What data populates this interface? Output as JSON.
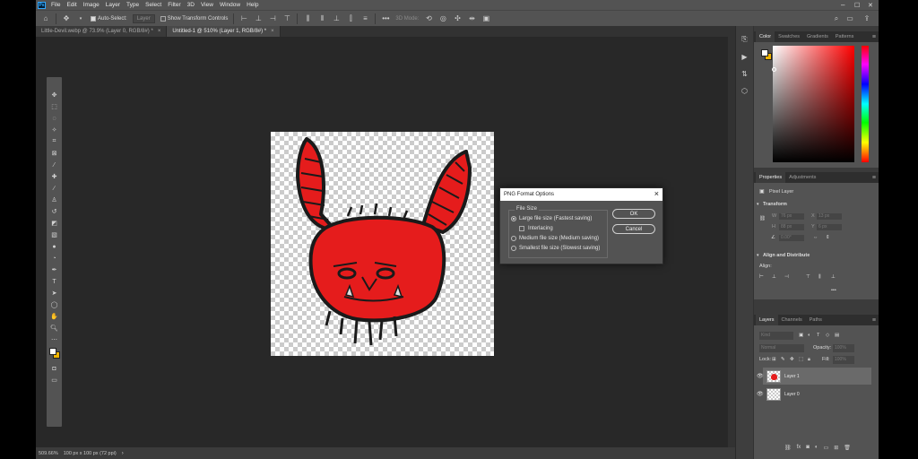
{
  "menubar": {
    "logo": "Ps",
    "items": [
      "File",
      "Edit",
      "Image",
      "Layer",
      "Type",
      "Select",
      "Filter",
      "3D",
      "View",
      "Window",
      "Help"
    ],
    "minimize": "–",
    "maximize": "☐",
    "close": "✕"
  },
  "options": {
    "auto_select_label": "Auto-Select:",
    "auto_select_checked": true,
    "target_value": "Layer",
    "show_transform_label": "Show Transform Controls",
    "mode_3d": "3D Mode:"
  },
  "tabs": [
    {
      "label": "Little-Devil.webp @ 73.9% (Layer 0, RGB/8#) *",
      "active": false
    },
    {
      "label": "Untitled-1 @ 510% (Layer 1, RGB/8#) *",
      "active": true
    }
  ],
  "status": {
    "zoom": "509.66%",
    "doc_info": "100 px x 100 px (72 ppi)"
  },
  "dialog": {
    "title": "PNG Format Options",
    "group_label": "File Size",
    "options": [
      {
        "label": "Large file size (Fastest saving)",
        "selected": true
      },
      {
        "label": "Medium file size (Medium saving)",
        "selected": false
      },
      {
        "label": "Smallest file size (Slowest saving)",
        "selected": false
      }
    ],
    "interlacing_label": "Interlacing",
    "interlacing_checked": false,
    "ok_label": "OK",
    "cancel_label": "Cancel"
  },
  "color_panel": {
    "tabs": [
      "Color",
      "Swatches",
      "Gradients",
      "Patterns"
    ],
    "active_tab": "Color",
    "foreground": "#ffffff",
    "background": "#f0b400"
  },
  "properties_panel": {
    "tabs": [
      "Properties",
      "Adjustments"
    ],
    "active_tab": "Properties",
    "layer_type": "Pixel Layer",
    "transform_label": "Transform",
    "w_label": "W",
    "h_label": "H",
    "x_label": "X",
    "y_label": "Y",
    "w_value": "76 px",
    "h_value": "88 px",
    "x_value": "13 px",
    "y_value": "6 px",
    "angle_value": "0.00°",
    "align_label": "Align and Distribute",
    "align_sub": "Align:",
    "more": "•••"
  },
  "layers_panel": {
    "tabs": [
      "Layers",
      "Channels",
      "Paths"
    ],
    "active_tab": "Layers",
    "filter_placeholder": "Kind",
    "blend_mode": "Normal",
    "opacity_label": "Opacity:",
    "opacity_value": "100%",
    "lock_label": "Lock:",
    "fill_label": "Fill:",
    "fill_value": "100%",
    "layers": [
      {
        "name": "Layer 1",
        "selected": true,
        "visible": true
      },
      {
        "name": "Layer 0",
        "selected": false,
        "visible": true
      }
    ]
  },
  "colors": {
    "accent": "#31a8ff",
    "devil_red": "#e51c1c",
    "devil_outline": "#1a1a1a"
  }
}
